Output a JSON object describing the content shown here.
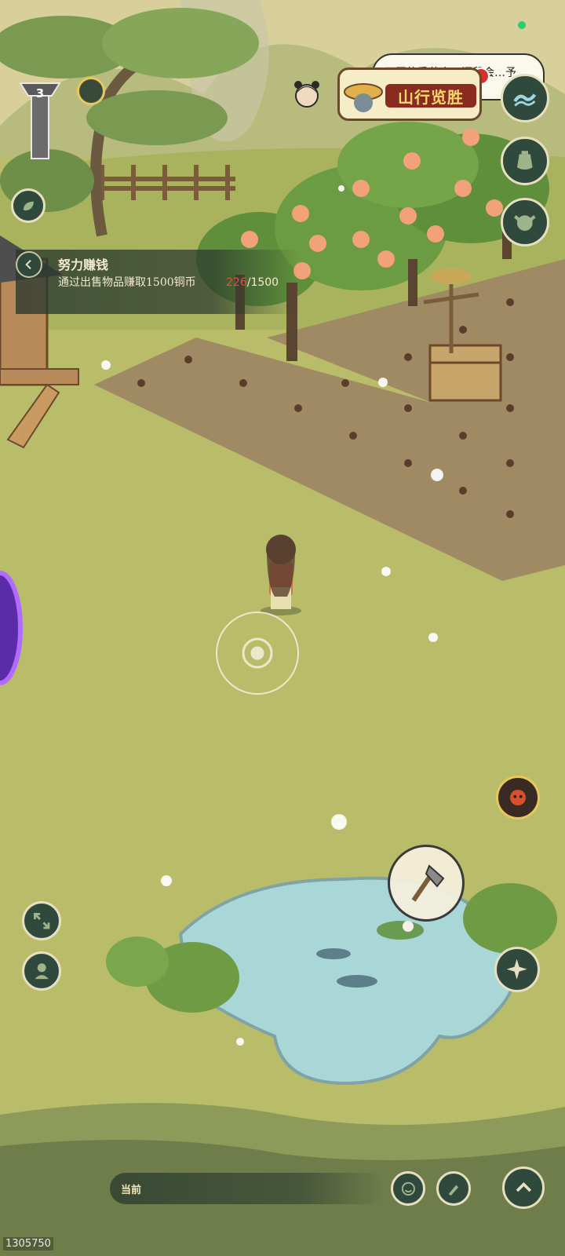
{
  "quest": {
    "title": "努力赚钱",
    "description": "通过出售物品赚取1500铜币",
    "progress_current": "226",
    "progress_total": "/1500"
  },
  "banner": {
    "label": "山行览胜",
    "tip_text": "不同的季节会…间段会…予"
  },
  "player_level": "3",
  "chat": {
    "channel_label": "当前"
  },
  "user_id": "1305750",
  "icons": {
    "wave": "wave-icon",
    "pot": "pot-icon",
    "ox": "ox-icon",
    "leaf": "leaf-icon",
    "back": "chevron-left-icon",
    "axe": "axe-icon",
    "mask": "mask-icon",
    "expand": "expand-icon",
    "person": "person-icon",
    "compass": "compass-icon",
    "emoji": "emoji-icon",
    "brush": "brush-icon",
    "up": "chevron-up-icon"
  },
  "colors": {
    "grass": "#b9bd6a",
    "hud_dark": "#2f4a3c",
    "hud_border": "#e8dfc0",
    "progress_current": "#e0503c",
    "status": "#2ecc71"
  }
}
